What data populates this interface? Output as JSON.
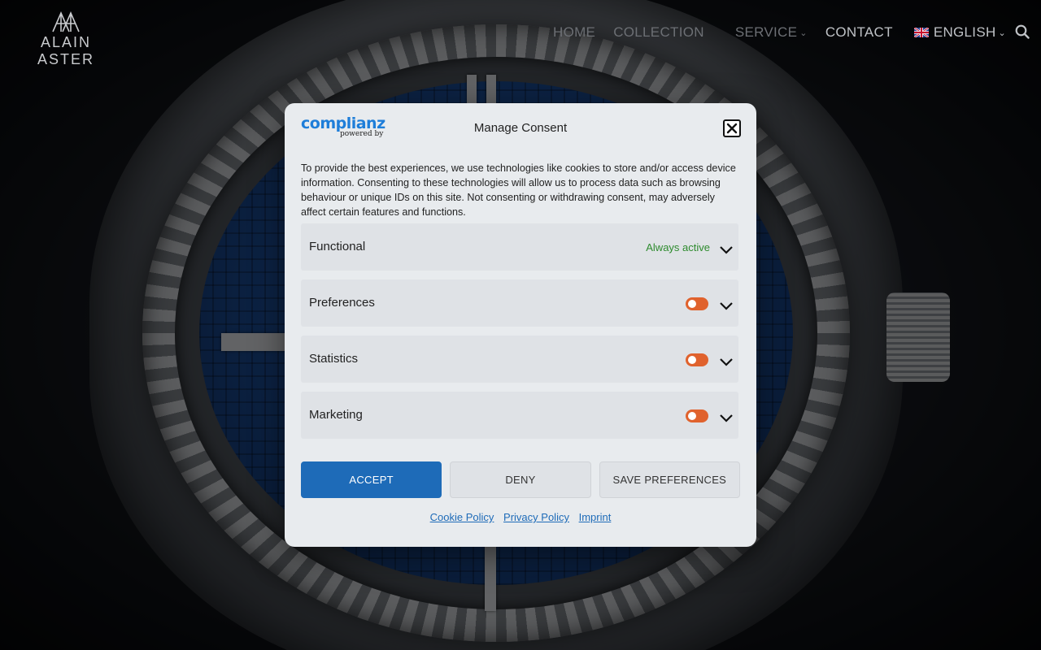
{
  "header": {
    "logo_text": "ALAIN ASTER",
    "nav": [
      {
        "label": "HOME"
      },
      {
        "label": "COLLECTION"
      },
      {
        "label": "SERVICE"
      },
      {
        "label": "CONTACT"
      },
      {
        "label": "ENGLISH"
      }
    ]
  },
  "consent": {
    "brand": "complianz",
    "brand_tag": "powered by",
    "title": "Manage Consent",
    "message": "To provide the best experiences, we use technologies like cookies to store and/or access device information. Consenting to these technologies will allow us to process data such as browsing behaviour or unique IDs on this site. Not consenting or withdrawing consent, may adversely affect certain features and functions.",
    "categories": [
      {
        "title": "Functional",
        "status": "Always active"
      },
      {
        "title": "Preferences",
        "enabled": false
      },
      {
        "title": "Statistics",
        "enabled": false
      },
      {
        "title": "Marketing",
        "enabled": false
      }
    ],
    "buttons": {
      "accept": "ACCEPT",
      "deny": "DENY",
      "save": "SAVE PREFERENCES"
    },
    "links": {
      "cookie_policy": "Cookie Policy",
      "privacy_policy": "Privacy Policy",
      "imprint": "Imprint"
    }
  },
  "colors": {
    "accent": "#1e6bb8",
    "toggle": "#e0622d",
    "always_active": "#2e8b2e"
  }
}
